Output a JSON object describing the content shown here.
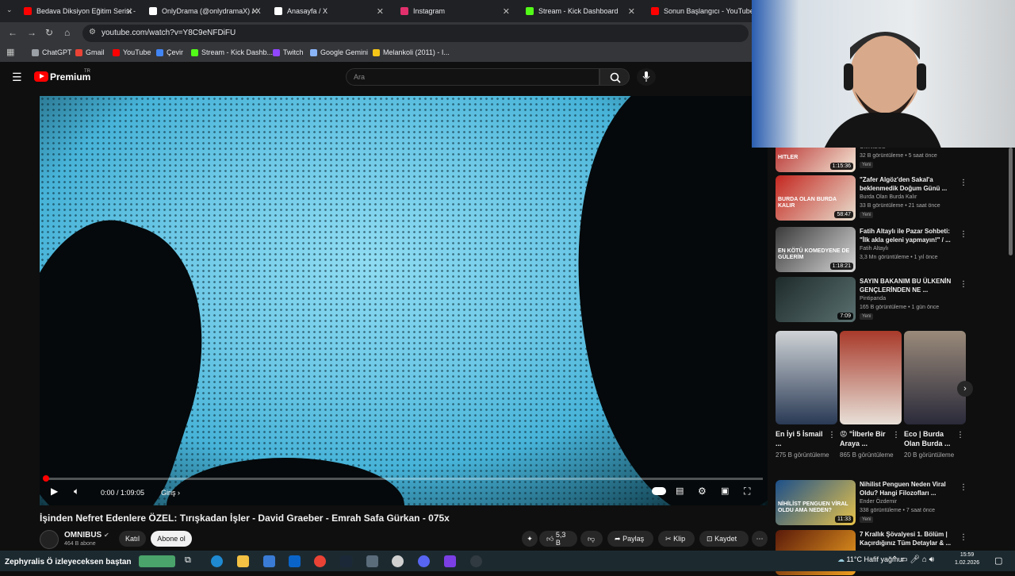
{
  "browser": {
    "tabs": [
      {
        "label": "Bedava Diksiyon Eğitim Serisi -",
        "color": "#ff0000"
      },
      {
        "label": "OnlyDrama (@onlydramaX) / X",
        "color": "#ffffff"
      },
      {
        "label": "Anasayfa / X",
        "color": "#ffffff"
      },
      {
        "label": "Instagram",
        "color": "#e1306c"
      },
      {
        "label": "Stream - Kick Dashboard",
        "color": "#53fc18"
      },
      {
        "label": "Sonun Başlangıcı - YouTube",
        "color": "#ff0000"
      }
    ],
    "url": "youtube.com/watch?v=Y8C9eNFDiFU",
    "bookmarks": [
      {
        "label": "ChatGPT",
        "color": "#9aa0a6"
      },
      {
        "label": "Gmail",
        "color": "#ea4335"
      },
      {
        "label": "YouTube",
        "color": "#ff0000"
      },
      {
        "label": "Çevir",
        "color": "#4285f4"
      },
      {
        "label": "Stream - Kick Dashb...",
        "color": "#53fc18"
      },
      {
        "label": "Twitch",
        "color": "#9146ff"
      },
      {
        "label": "Google Gemini",
        "color": "#8ab4f8"
      },
      {
        "label": "Melankoli (2011) - I...",
        "color": "#f5c518"
      }
    ]
  },
  "youtube": {
    "brand": "Premium",
    "region": "TR",
    "search_placeholder": "Ara",
    "video": {
      "time": "0:00 / 1:09:05",
      "chapter": "Giriş",
      "title": "İşinden Nefret Edenlere ÖZEL: Tırışkadan İşler - David Graeber - Emrah Safa Gürkan - 075x",
      "channel": "OMNIBUS",
      "subscribers": "464 B abone",
      "join_label": "Katıl",
      "subscribe_label": "Abone ol",
      "likes": "5,3 B",
      "share_label": "Paylaş",
      "clip_label": "Klip",
      "save_label": "Kaydet"
    },
    "recommended": [
      {
        "thumb_text": "HITLER",
        "duration": "1:15:36",
        "title": "",
        "channel": "OMNIBUS",
        "meta": "32 B görüntüleme • 5 saat önce",
        "badge": "Yeni",
        "colors": [
          "#b01818",
          "#f4e9d8"
        ]
      },
      {
        "thumb_text": "BURDA OLAN BURDA KALIR",
        "duration": "58:47",
        "title": "\"Zafer Algöz'den Sakal'a beklenmedik Doğum Günü ...",
        "channel": "Burda Olan Burda Kalır",
        "meta": "33 B görüntüleme • 21 saat önce",
        "badge": "Yeni",
        "colors": [
          "#c4261f",
          "#e8e0d0"
        ]
      },
      {
        "thumb_text": "EN KÖTÜ KOMEDYENE DE GÜLERİM",
        "duration": "1:18:21",
        "title": "Fatih Altaylı ile Pazar Sohbeti: \"İlk akla geleni yapmayın!\" / ...",
        "channel": "Fatih Altaylı",
        "meta": "3,3 Mn görüntüleme • 1 yıl önce",
        "badge": "",
        "colors": [
          "#3a3a3a",
          "#d8d8d8"
        ]
      },
      {
        "thumb_text": "",
        "duration": "7:09",
        "title": "SAYIN BAKANIM BU ÜLKENİN GENÇLERİNDEN NE ...",
        "channel": "Pintipanda",
        "meta": "165 B görüntüleme • 1 gün önce",
        "badge": "Yeni",
        "colors": [
          "#1e2a2a",
          "#5a7070"
        ]
      },
      {
        "thumb_text": "NİHİLİST PENGUEN VİRAL OLDU AMA NEDEN?",
        "duration": "11:33",
        "title": "Nihilist Penguen Neden Viral Oldu? Hangi Filozofları ...",
        "channel": "Ender Özdemir",
        "meta": "338 görüntüleme • 7 saat önce",
        "badge": "Yeni",
        "colors": [
          "#1b4f8a",
          "#e8c34a"
        ]
      },
      {
        "thumb_text": "",
        "duration": "",
        "title": "7 Krallık Şövalyesi 1. Bölüm | Kaçırdığınız Tüm Detaylar & ...",
        "channel": "",
        "meta": "",
        "badge": "",
        "colors": [
          "#5a1a0a",
          "#f0a020"
        ]
      }
    ],
    "shorts": [
      {
        "title": "En İyi 5 İsmail ...",
        "meta": "275 B görüntüleme",
        "colors": [
          "#cfd3d6",
          "#2a3a55"
        ]
      },
      {
        "title": "😡 \"İlberle Bir Araya ...",
        "meta": "865 B görüntüleme",
        "colors": [
          "#a83a2a",
          "#e8e0d8"
        ]
      },
      {
        "title": "Eco | Burda Olan Burda ...",
        "meta": "20 B görüntüleme",
        "colors": [
          "#9a8a7a",
          "#2a2a3a"
        ]
      }
    ]
  },
  "taskbar": {
    "marquee": "Zephyralis Ö izleyeceksen baştan",
    "weather": "11°C  Hafif yağmur",
    "time": "15:59",
    "date": "1.02.2026"
  }
}
